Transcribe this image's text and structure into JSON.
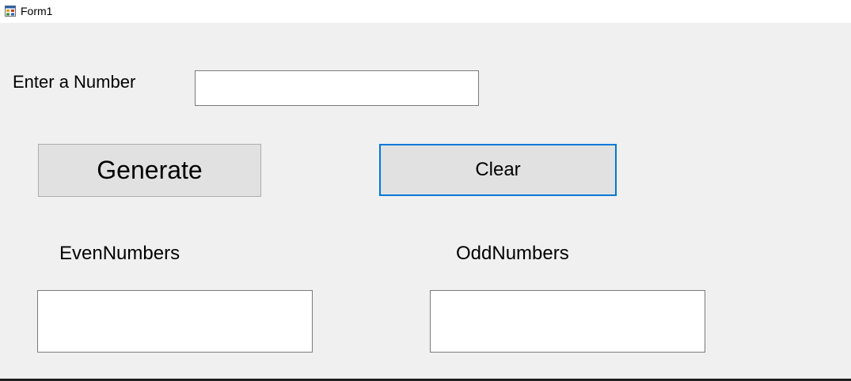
{
  "window": {
    "title": "Form1",
    "icon": "form-app-icon"
  },
  "form": {
    "number_label": "Enter a Number",
    "number_value": "",
    "generate_label": "Generate",
    "clear_label": "Clear",
    "even_label": "EvenNumbers",
    "even_value": "",
    "odd_label": "OddNumbers",
    "odd_value": ""
  },
  "colors": {
    "form_background": "#f0f0f0",
    "button_face": "#e1e1e1",
    "focus_border": "#0078d7"
  }
}
